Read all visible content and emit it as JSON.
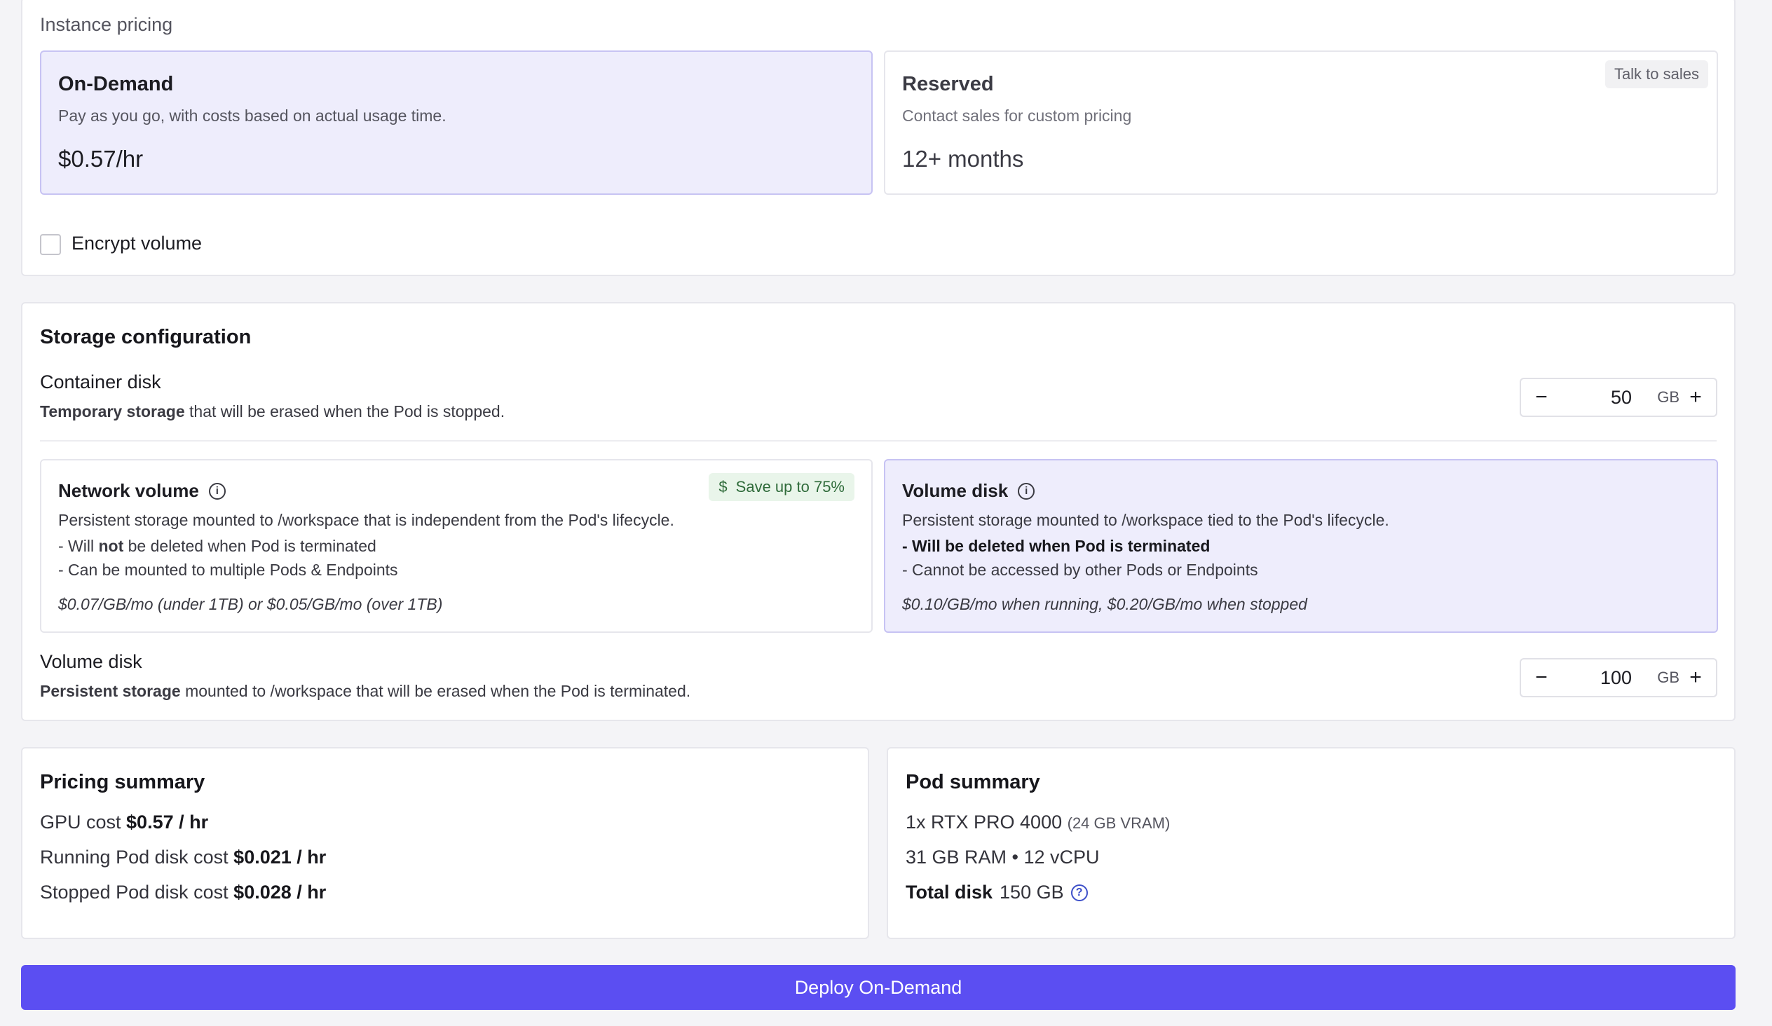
{
  "instance_pricing": {
    "label": "Instance pricing",
    "on_demand": {
      "title": "On-Demand",
      "desc": "Pay as you go, with costs based on actual usage time.",
      "price": "$0.57/hr"
    },
    "reserved": {
      "title": "Reserved",
      "desc": "Contact sales for custom pricing",
      "price": "12+ months",
      "badge": "Talk to sales"
    },
    "encrypt_label": "Encrypt volume"
  },
  "storage": {
    "title": "Storage configuration",
    "container_disk": {
      "label": "Container disk",
      "desc_bold": "Temporary storage",
      "desc_rest": " that will be erased when the Pod is stopped.",
      "value": "50",
      "unit": "GB"
    },
    "network_volume": {
      "title": "Network volume",
      "badge": "Save up to 75%",
      "desc": "Persistent storage mounted to /workspace that is independent from the Pod's lifecycle.",
      "b1_pre": "- Will ",
      "b1_bold": "not",
      "b1_post": " be deleted when Pod is terminated",
      "b2": "- Can be mounted to multiple Pods & Endpoints",
      "price": "$0.07/GB/mo (under 1TB) or $0.05/GB/mo (over 1TB)"
    },
    "volume_disk_option": {
      "title": "Volume disk",
      "desc": "Persistent storage mounted to /workspace tied to the Pod's lifecycle.",
      "b1": "- Will be deleted when Pod is terminated",
      "b2": "- Cannot be accessed by other Pods or Endpoints",
      "price": "$0.10/GB/mo when running, $0.20/GB/mo when stopped"
    },
    "volume_disk": {
      "label": "Volume disk",
      "desc_bold": "Persistent storage",
      "desc_rest": " mounted to /workspace that will be erased when the Pod is terminated.",
      "value": "100",
      "unit": "GB"
    }
  },
  "pricing_summary": {
    "title": "Pricing summary",
    "gpu_label": "GPU cost ",
    "gpu_value": "$0.57 / hr",
    "running_label": "Running Pod disk cost ",
    "running_value": "$0.021 / hr",
    "stopped_label": "Stopped Pod disk cost ",
    "stopped_value": "$0.028 / hr"
  },
  "pod_summary": {
    "title": "Pod summary",
    "gpu": "1x RTX PRO 4000",
    "gpu_vram": "(24 GB VRAM)",
    "specs": "31 GB RAM • 12 vCPU",
    "total_disk_label": "Total disk",
    "total_disk_value": "150 GB"
  },
  "deploy_label": "Deploy On-Demand",
  "icons": {
    "minus": "−",
    "plus": "+",
    "info": "i",
    "help": "?",
    "dollar": "$"
  },
  "colors": {
    "accent": "#5b4ef2",
    "selected_bg": "#eeedfc",
    "save_badge": "#e9f5ea"
  }
}
